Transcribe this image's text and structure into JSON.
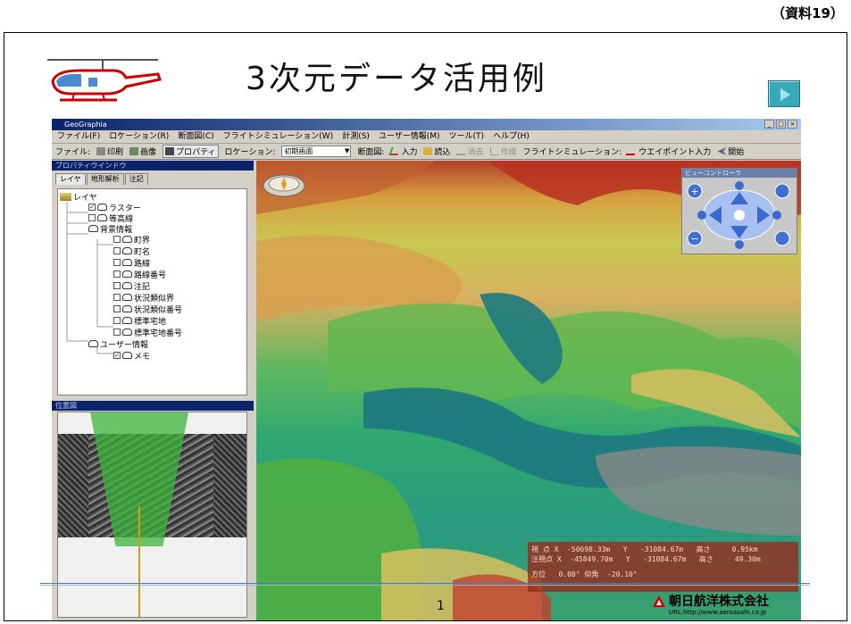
{
  "doc_label": "（資料19）",
  "slide": {
    "title": "3次元データ活用例",
    "page_number": "1",
    "company": "朝日航洋株式会社",
    "url": "URL.http://www.aeroasahi.co.jp"
  },
  "app": {
    "window_title": "GeoGraphia",
    "window_buttons": [
      "_",
      "□",
      "×"
    ],
    "menu": [
      "ファイル(F)",
      "ロケーション(R)",
      "断面図(C)",
      "フライトシミュレーション(W)",
      "計測(S)",
      "ユーザー情報(M)",
      "ツール(T)",
      "ヘルプ(H)"
    ],
    "toolbar": {
      "file_label": "ファイル:",
      "print": "印刷",
      "image": "画像",
      "property": "プロパティ",
      "location_label": "ロケーション:",
      "location_value": "初期画面",
      "section_label": "断面図:",
      "input": "入力",
      "read": "読込",
      "erase": "消去",
      "create": "作成",
      "flight_label": "フライトシミュレーション:",
      "waypoint": "ウエイポイント入力",
      "start": "開始"
    },
    "property_window": {
      "caption": "プロパティウインドウ",
      "tabs": [
        "レイヤ",
        "地形解析",
        "注記"
      ],
      "tree": {
        "root": "レイヤ",
        "raster": "ラスター",
        "contour": "等高線",
        "background": "背景情報",
        "town_boundary": "町界",
        "town_name": "町名",
        "route": "路線",
        "route_number": "路線番号",
        "annotation": "注記",
        "similar_boundary": "状況類似界",
        "similar_number": "状況類似番号",
        "standard_land": "標準宅地",
        "standard_land_number": "標準宅地番号",
        "user_info": "ユーザー情報",
        "memo": "メモ"
      }
    },
    "location_window": {
      "caption": "位置図"
    },
    "view_controller": {
      "caption": "ビューコントローラ"
    },
    "readout": {
      "line1": "視 点 X  -50698.33m   Y   -31084.67m   高さ     0.95km",
      "line2": "注視点 X  -45849.70m   Y   -31084.67m   高さ     49.30m",
      "line3": "方位   0.00° 仰角  -20.10°"
    }
  },
  "colors": {
    "accent": "#0a246a",
    "panel": "#d4d0c8",
    "readout_bg": "#962d1e",
    "next_button": "#3aa8b8"
  }
}
